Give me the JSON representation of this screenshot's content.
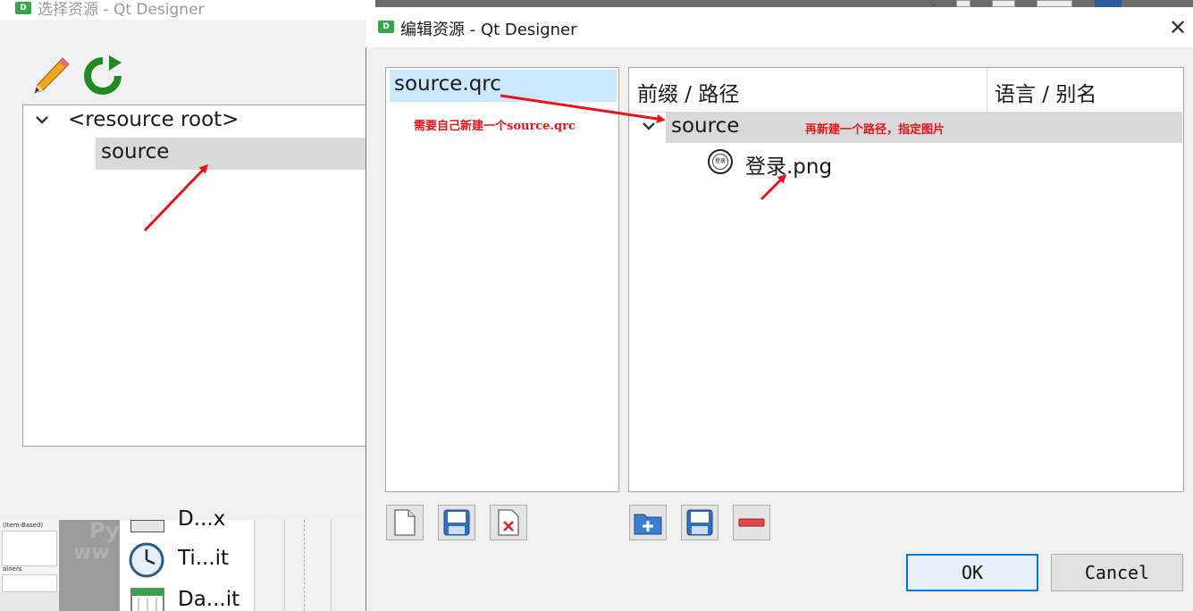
{
  "background_window": {
    "title": "选择资源 - Qt Designer",
    "tree": {
      "root_label": "<resource root>",
      "child_label": "source"
    }
  },
  "background_widgets": {
    "panel_label_1": "(Item-Based)",
    "panel_label_2": "ainers",
    "items": [
      {
        "label": "D...x"
      },
      {
        "label": "Ti...it"
      },
      {
        "label": "Da...it"
      }
    ]
  },
  "dialog": {
    "title": "编辑资源 - Qt Designer",
    "file_list": {
      "items": [
        "source.qrc"
      ],
      "annotation": "需要自己新建一个source.qrc"
    },
    "resource_tree": {
      "columns": [
        "前缀 / 路径",
        "语言 / 别名"
      ],
      "prefix": "source",
      "file": "登录.png",
      "file_icon_text": "登录",
      "annotation": "再新建一个路径，指定图片"
    },
    "buttons": {
      "ok": "OK",
      "cancel": "Cancel"
    }
  },
  "colors": {
    "selection": "#cce8ff",
    "row_highlight": "#d9d9d9",
    "annotation": "#e8141a",
    "accent": "#0078d7"
  }
}
